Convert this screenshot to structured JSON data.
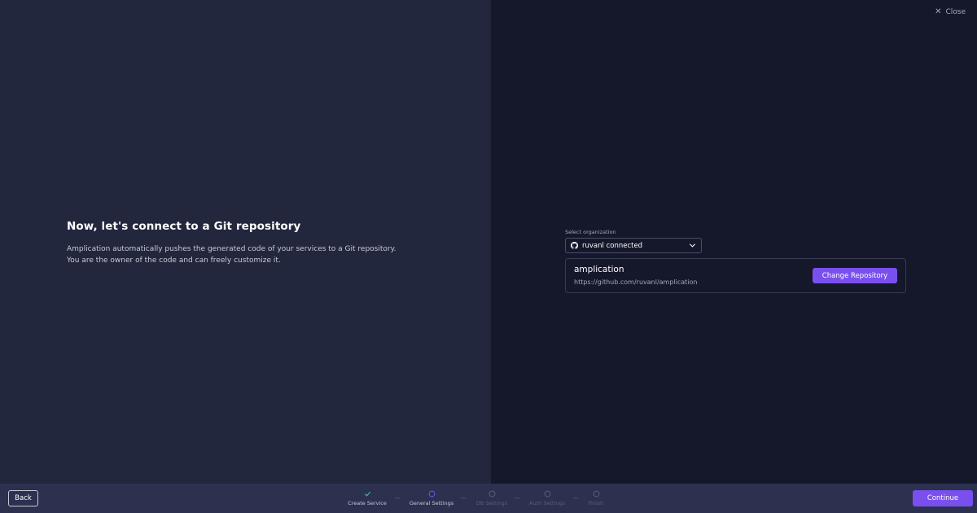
{
  "header": {
    "close_label": "Close"
  },
  "intro": {
    "title": "Now, let's connect to a Git repository",
    "line1": "Amplication automatically pushes the generated code of your services to a Git repository.",
    "line2": "You are the owner of the code and can freely customize it."
  },
  "organization": {
    "label": "Select organization",
    "selected": "ruvanl connected",
    "icon": "github-icon"
  },
  "repository": {
    "name": "amplication",
    "url": "https://github.com/ruvanl/amplication",
    "change_label": "Change Repository"
  },
  "footer": {
    "back_label": "Back",
    "continue_label": "Continue",
    "steps": [
      {
        "label": "Create Service",
        "state": "done"
      },
      {
        "label": "General Settings",
        "state": "active"
      },
      {
        "label": "DB Settings",
        "state": "pending"
      },
      {
        "label": "Auth Settings",
        "state": "pending"
      },
      {
        "label": "Finish",
        "state": "pending"
      }
    ]
  },
  "colors": {
    "accent": "#7950ed",
    "success": "#31c587",
    "left_bg": "#22273d",
    "right_bg": "#15172b",
    "footer_bg": "#2c3150"
  }
}
